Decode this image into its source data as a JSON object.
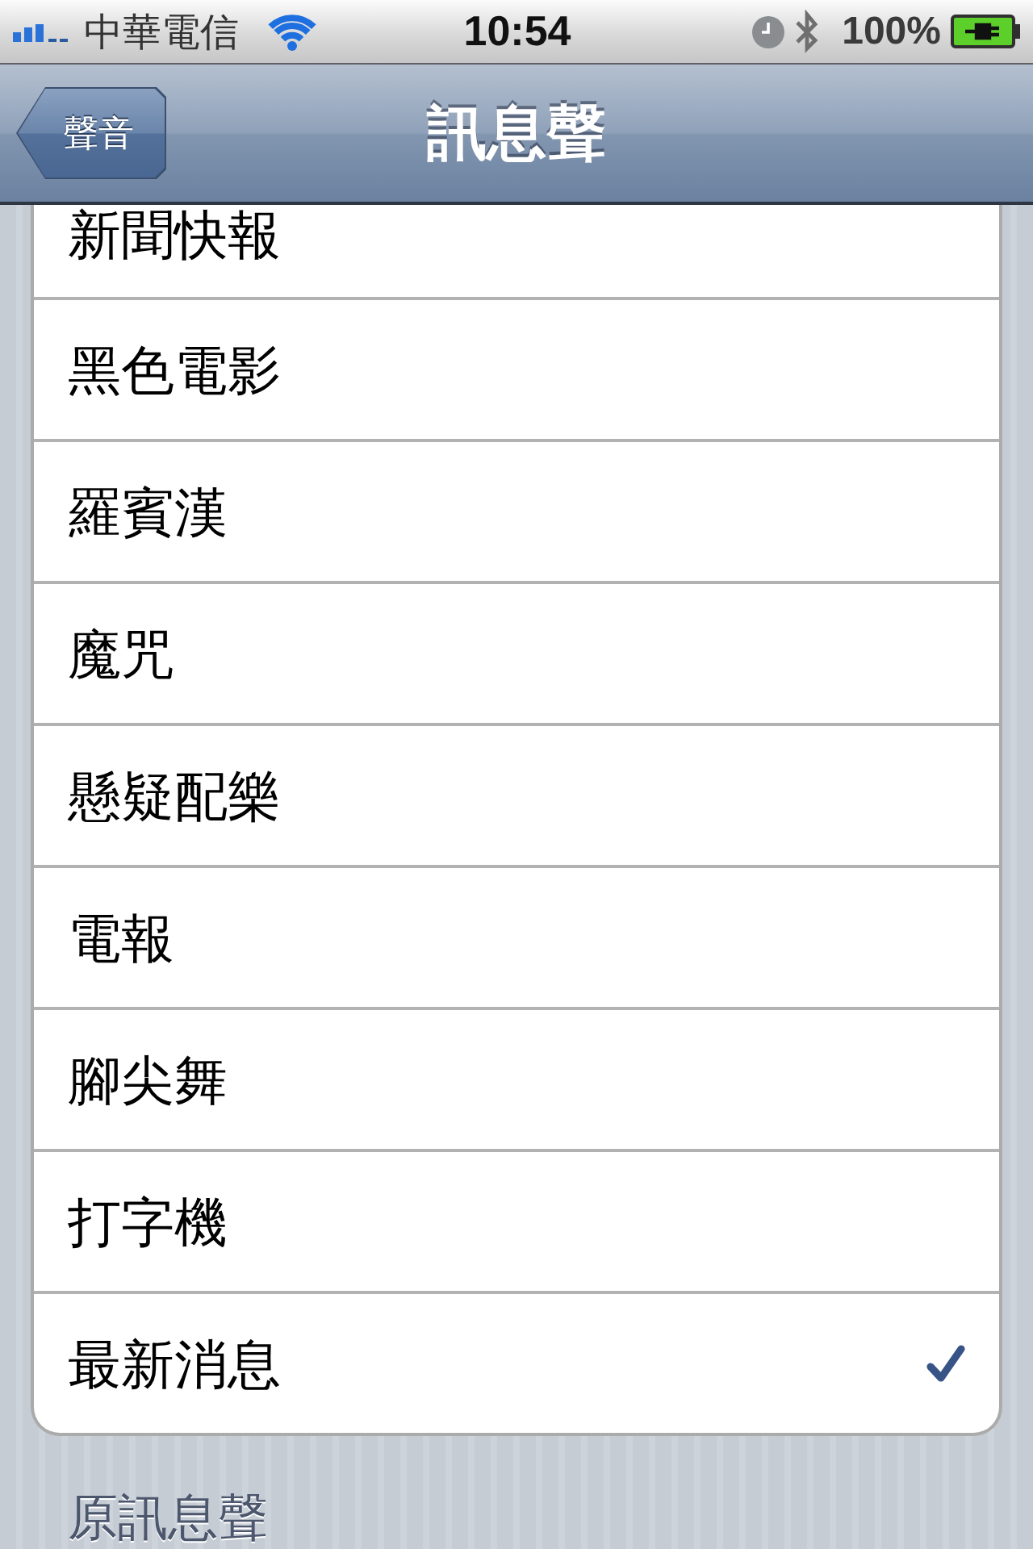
{
  "status_bar": {
    "carrier": "中華電信",
    "time": "10:54",
    "battery": "100%"
  },
  "nav_bar": {
    "back_button": "聲音",
    "title": "訊息聲"
  },
  "tones": [
    {
      "label": "新聞快報",
      "selected": false
    },
    {
      "label": "黑色電影",
      "selected": false
    },
    {
      "label": "羅賓漢",
      "selected": false
    },
    {
      "label": "魔咒",
      "selected": false
    },
    {
      "label": "懸疑配樂",
      "selected": false
    },
    {
      "label": "電報",
      "selected": false
    },
    {
      "label": "腳尖舞",
      "selected": false
    },
    {
      "label": "打字機",
      "selected": false
    },
    {
      "label": "最新消息",
      "selected": true
    }
  ],
  "section_header": "原訊息聲"
}
